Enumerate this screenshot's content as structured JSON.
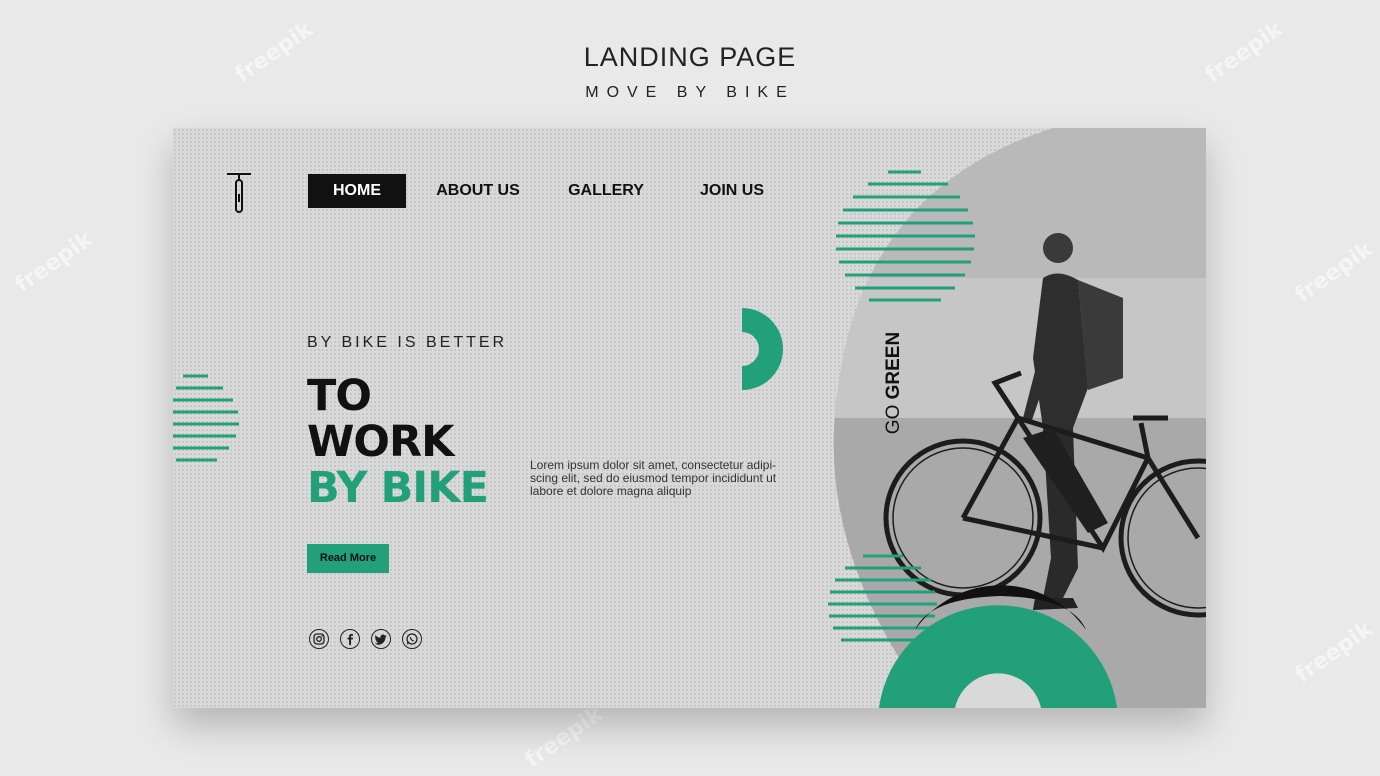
{
  "header": {
    "title": "LANDING PAGE",
    "subtitle": "MOVE BY BIKE"
  },
  "watermark": "freepik",
  "nav": {
    "items": [
      {
        "label": "HOME"
      },
      {
        "label": "ABOUT US"
      },
      {
        "label": "GALLERY"
      },
      {
        "label": "JOIN US"
      }
    ]
  },
  "hero": {
    "eyebrow": "BY BIKE IS BETTER",
    "line1": "TO",
    "line2": "WORK",
    "line3": "BY BIKE",
    "body": "Lorem ipsum dolor sit amet, consectetur adipi-scing elit, sed do eiusmod tempor incididunt ut labore et dolore magna aliquip",
    "cta": "Read More",
    "side_text": "GO GREEN"
  },
  "social": [
    "instagram-icon",
    "facebook-icon",
    "twitter-icon",
    "whatsapp-icon"
  ],
  "colors": {
    "accent": "#21a07a",
    "dark": "#111111",
    "card": "#d9d9d9",
    "background": "#e9e9e9"
  }
}
